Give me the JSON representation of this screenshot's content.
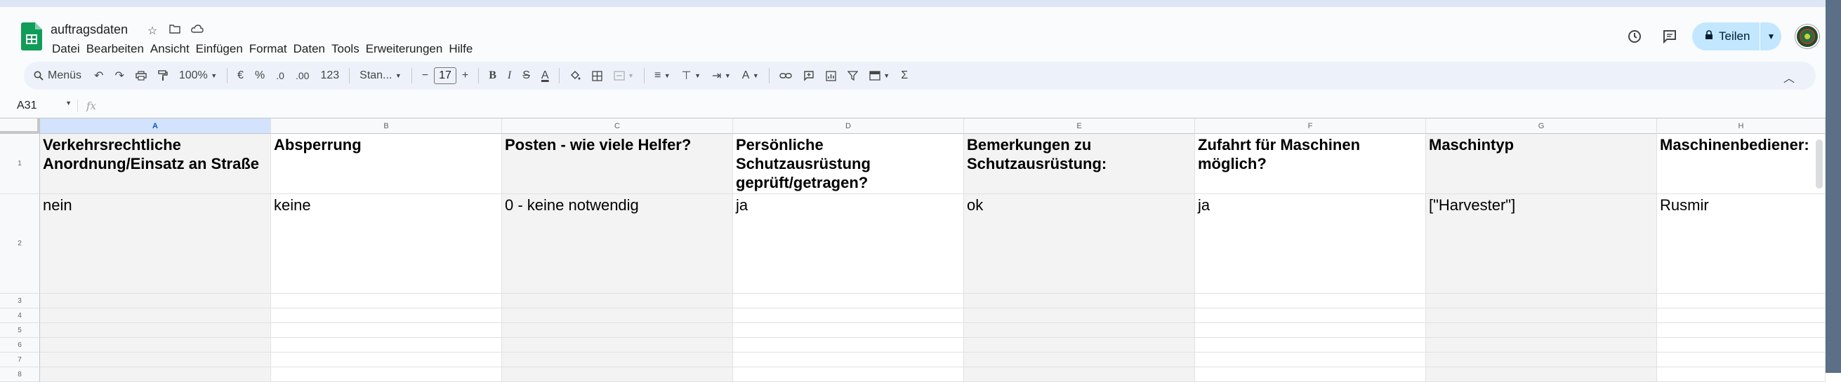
{
  "app": {
    "doc_title": "auftragsdaten",
    "menu": [
      "Datei",
      "Bearbeiten",
      "Ansicht",
      "Einfügen",
      "Format",
      "Daten",
      "Tools",
      "Erweiterungen",
      "Hilfe"
    ],
    "share_label": "Teilen"
  },
  "toolbar": {
    "search_label": "Menüs",
    "zoom": "100%",
    "currency": "€",
    "percent": "%",
    "dec_decrease": ".0",
    "dec_increase": ".00",
    "number_format": "123",
    "font": "Stan...",
    "font_size": "17",
    "sigma": "Σ"
  },
  "formula_bar": {
    "cell_ref": "A31",
    "fx": "fx",
    "formula": ""
  },
  "sheet": {
    "columns": [
      "A",
      "B",
      "C",
      "D",
      "E",
      "F",
      "G",
      "H"
    ],
    "row_numbers": [
      "1",
      "2",
      "3",
      "4",
      "5",
      "6",
      "7",
      "8"
    ],
    "rows": [
      [
        "Verkehrsrechtliche Anordnung/Einsatz an Straße",
        "Absperrung",
        "Posten - wie viele Helfer?",
        "Persönliche Schutzausrüstung geprüft/getragen?",
        "Bemerkungen zu Schutzausrüstung:",
        "Zufahrt für Maschinen möglich?",
        "Maschintyp",
        "Maschinenbediener:"
      ],
      [
        "nein",
        "keine",
        "0 - keine notwendig",
        "ja",
        "ok",
        "ja",
        "[\"Harvester\"]",
        "Rusmir"
      ]
    ]
  },
  "colors": {
    "accent": "#0b57d0",
    "share_bg": "#c2e7ff",
    "shaded_column": "#f3f3f3",
    "sheets_green": "#0f9d58"
  }
}
